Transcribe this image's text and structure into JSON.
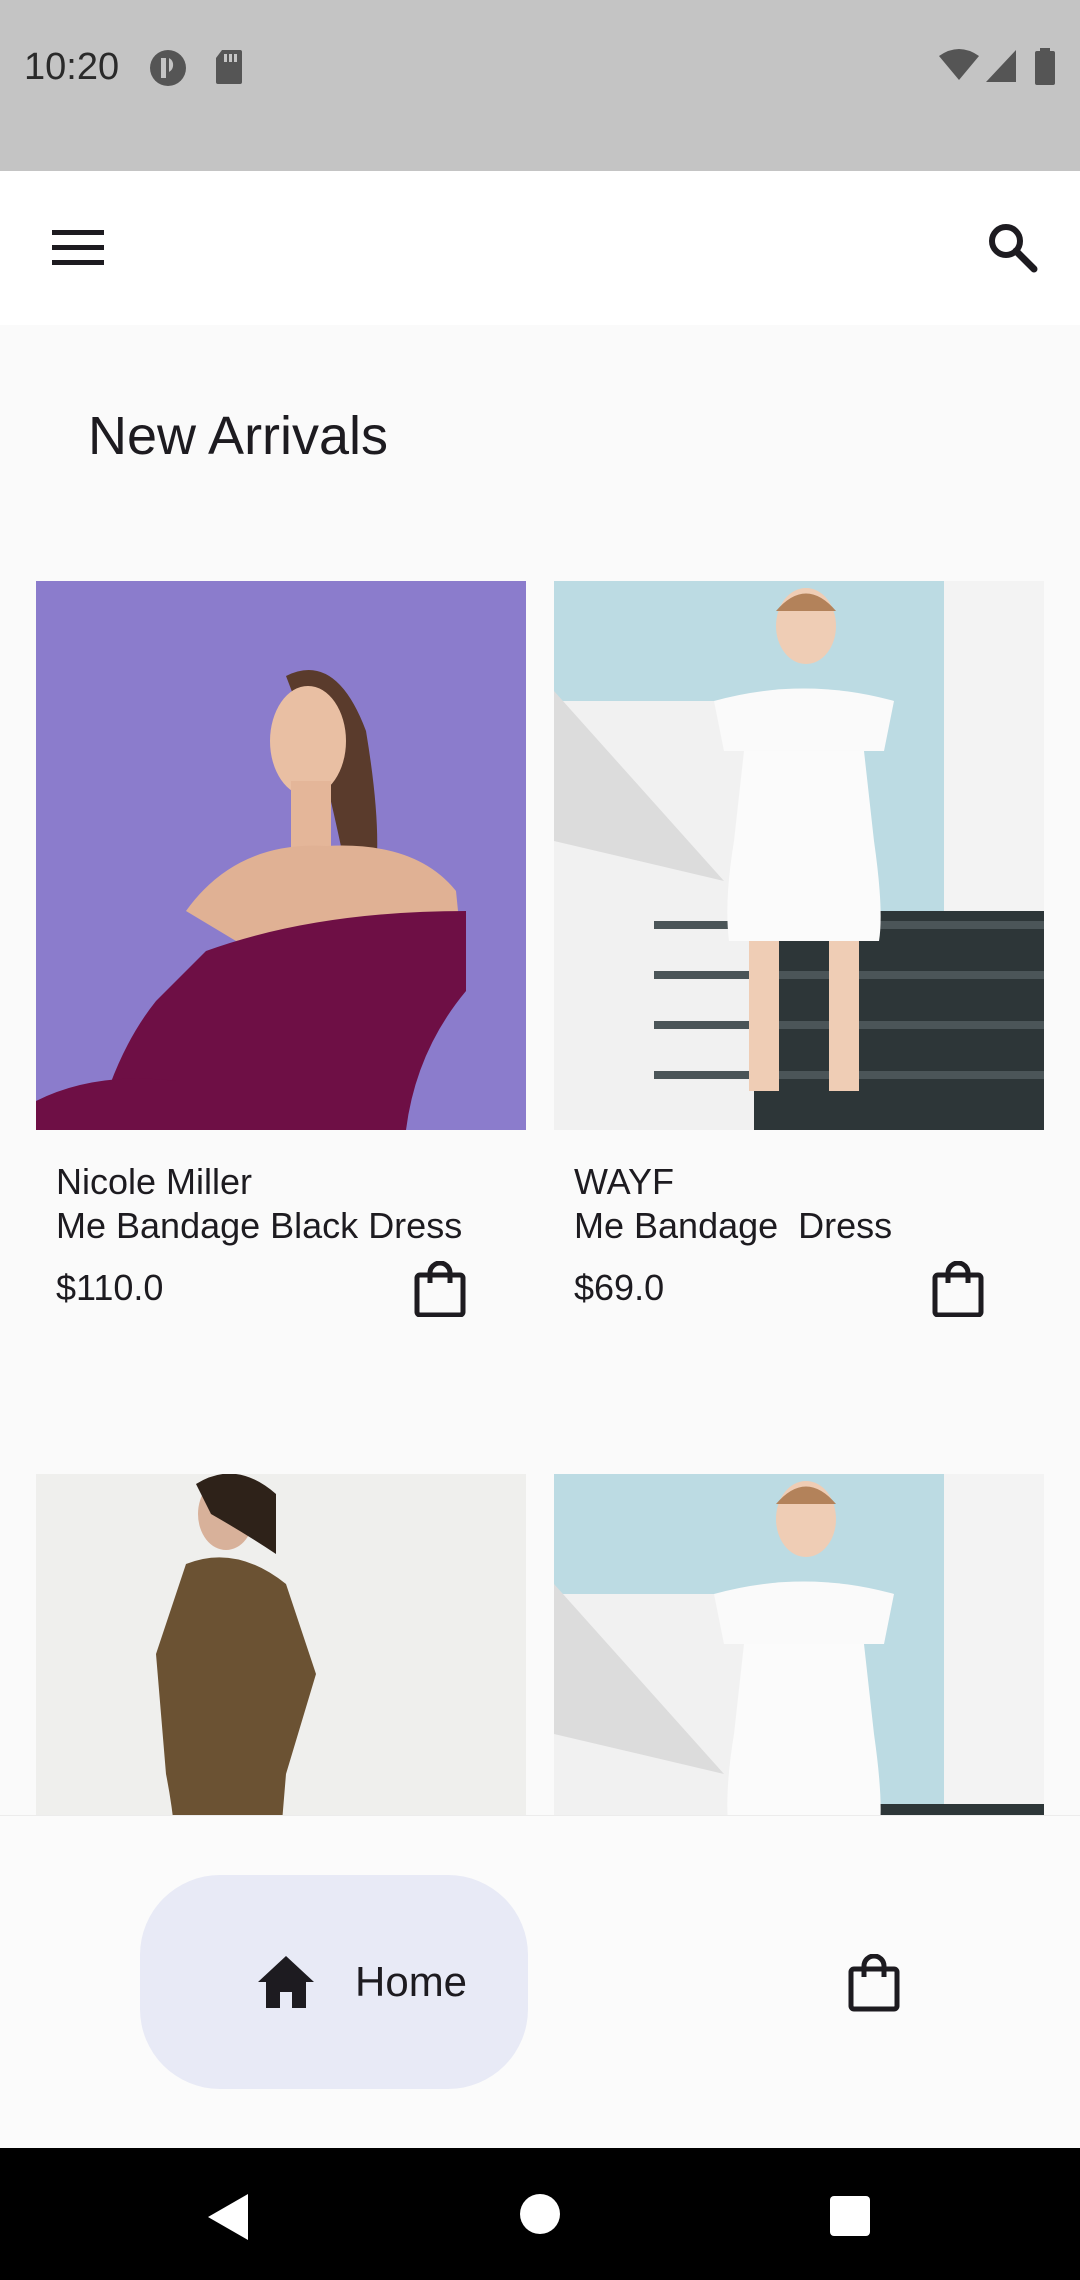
{
  "status_bar": {
    "time": "10:20"
  },
  "header": {
    "title": "New Arrivals"
  },
  "products": [
    {
      "brand": "Nicole Miller",
      "name": "Me Bandage Black Dress",
      "price": "$110.0"
    },
    {
      "brand": "WAYF",
      "name": "Me Bandage  Dress",
      "price": "$69.0"
    },
    {
      "brand": "",
      "name": "",
      "price": ""
    },
    {
      "brand": "",
      "name": "",
      "price": ""
    }
  ],
  "bottom_nav": {
    "home_label": "Home"
  },
  "icons": {
    "menu": "hamburger-menu-icon",
    "search": "search-icon",
    "cart": "shopping-bag-icon",
    "home": "home-icon"
  },
  "colors": {
    "nav_active_bg": "#e8eaf6",
    "status_bar": "#c4c4c4",
    "app_bg": "#fafafa"
  }
}
